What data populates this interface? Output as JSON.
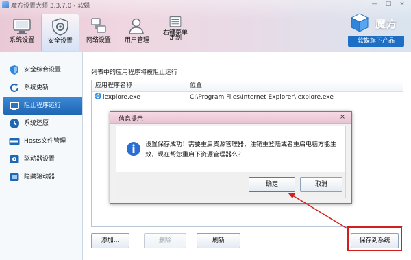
{
  "window": {
    "title": "魔方设置大师 3.3.7.0 - 软媒",
    "minimize": "—",
    "maximize": "□",
    "close": "×"
  },
  "toolbar": {
    "items": [
      {
        "label": "系统设置",
        "icon": "monitor-settings-icon"
      },
      {
        "label": "安全设置",
        "icon": "shield-gear-icon",
        "active": true
      },
      {
        "label": "网络设置",
        "icon": "network-icon"
      },
      {
        "label": "用户管理",
        "icon": "user-icon"
      },
      {
        "label1": "右键菜单",
        "label2": "定制",
        "icon": "context-menu-icon"
      }
    ]
  },
  "brand": {
    "name": "魔方",
    "sub": "软媒旗下产品",
    "icon": "rubik-cube-icon"
  },
  "sidebar": {
    "items": [
      {
        "label": "安全综合设置",
        "icon": "shield-icon"
      },
      {
        "label": "系统更新",
        "icon": "refresh-icon"
      },
      {
        "label": "阻止程序运行",
        "icon": "block-app-icon",
        "active": true
      },
      {
        "label": "系统还原",
        "icon": "restore-icon"
      },
      {
        "label": "Hosts文件管理",
        "icon": "hosts-icon"
      },
      {
        "label": "驱动器设置",
        "icon": "drive-icon"
      },
      {
        "label": "隐藏驱动器",
        "icon": "hidden-drive-icon"
      }
    ]
  },
  "main": {
    "caption": "列表中的应用程序将被阻止运行",
    "columns": [
      "应用程序名称",
      "位置"
    ],
    "rows": [
      {
        "name": "iexplore.exe",
        "path": "C:\\Program Files\\Internet Explorer\\iexplore.exe"
      }
    ],
    "buttons": {
      "add": "添加...",
      "delete": "删除",
      "refresh": "刷新",
      "save": "保存到系统"
    }
  },
  "dialog": {
    "title": "信息提示",
    "message": "设置保存成功！需要重启资源管理器、注销重登陆或者重启电脑方能生效，现在帮您重启下资源管理器么？",
    "ok": "确定",
    "cancel": "取消",
    "close": "×"
  },
  "colors": {
    "accent": "#1f66b3",
    "annotation": "#d11f1f"
  }
}
